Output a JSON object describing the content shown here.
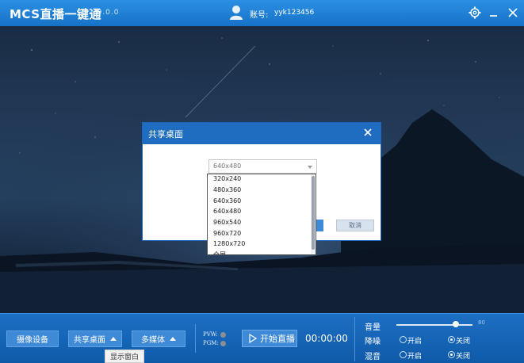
{
  "titlebar": {
    "app_name": "MCS直播一键通",
    "version": "2.0.0.0",
    "account_label": "账号:",
    "account_value": "yyk123456"
  },
  "dialog": {
    "title": "共享桌面",
    "selected_resolution": "640x480",
    "confirm_label": "",
    "cancel_label": "取消",
    "options": [
      "320x240",
      "480x360",
      "640x360",
      "640x480",
      "960x540",
      "960x720",
      "1280x720",
      "全屏"
    ]
  },
  "controls": {
    "camera_button": "摄像设备",
    "share_desktop_button": "共享桌面",
    "multimedia_button": "多媒体",
    "pvw_label": "PVW:",
    "pgm_label": "PGM:",
    "start_live_button": "开始直播",
    "timer": "00:00:00",
    "volume_label": "音量",
    "volume_value": "80",
    "noise_label": "降噪",
    "mix_label": "混音",
    "on_label": "开启",
    "off_label": "关闭",
    "tooltip": "显示窗白"
  },
  "state": {
    "volume": 80,
    "noise_reduction": "关闭",
    "mixing": "关闭"
  },
  "colors": {
    "brand_blue": "#1f6dc0",
    "titlebar_blue": "#2b8fe3",
    "bottombar_blue": "#1566b8"
  }
}
